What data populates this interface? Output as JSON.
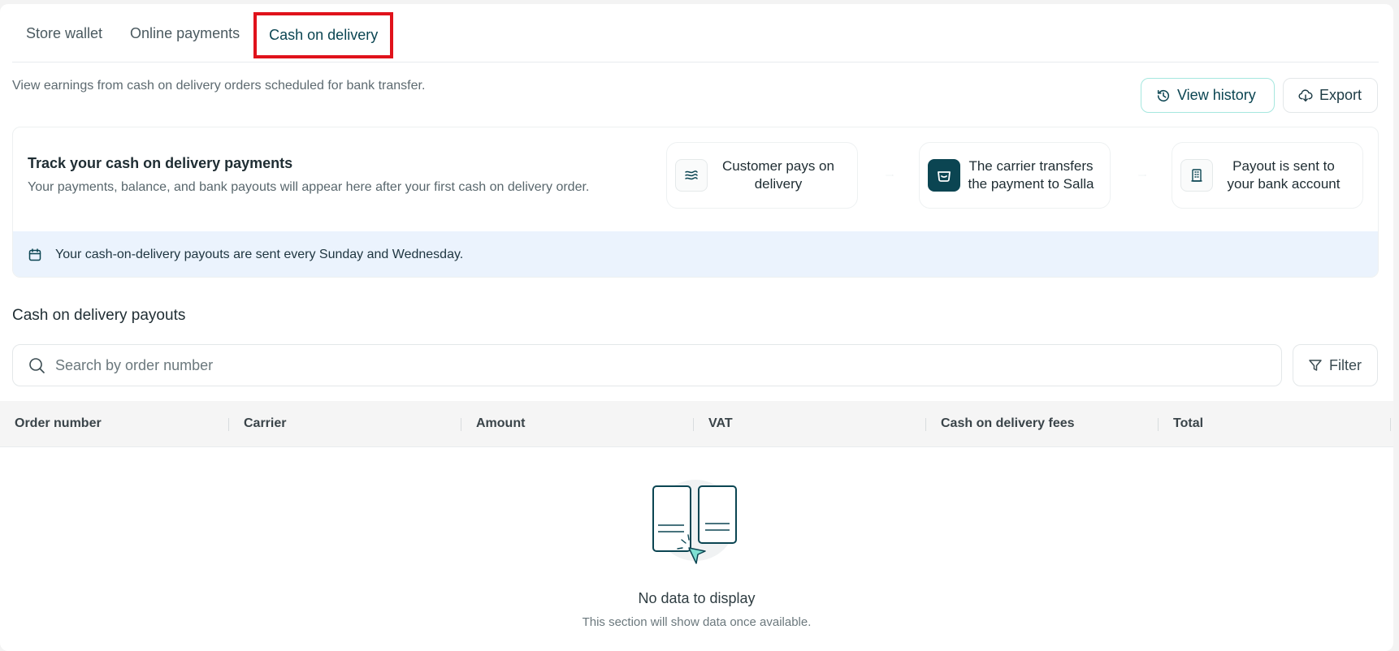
{
  "tabs": [
    {
      "label": "Store wallet"
    },
    {
      "label": "Online payments"
    },
    {
      "label": "Cash on delivery",
      "active": true
    }
  ],
  "subtitle": "View earnings from cash on delivery orders scheduled for bank transfer.",
  "actions": {
    "history_label": "View history",
    "export_label": "Export"
  },
  "tracker": {
    "title": "Track your cash on delivery payments",
    "description": "Your payments, balance, and bank payouts will appear here after your first cash on delivery order.",
    "steps": [
      {
        "label_line1": "Customer pays on",
        "label_line2": "delivery",
        "icon": "cash-icon"
      },
      {
        "label_line1": "The carrier transfers",
        "label_line2": "the payment to Salla",
        "icon": "salla-logo-icon"
      },
      {
        "label_line1": "Payout is sent to",
        "label_line2": "your bank account",
        "icon": "bank-building-icon"
      }
    ],
    "banner": "Your cash-on-delivery payouts are sent every Sunday and Wednesday."
  },
  "payouts": {
    "title": "Cash on delivery payouts",
    "search_placeholder": "Search by order number",
    "filter_label": "Filter",
    "columns": [
      "Order number",
      "Carrier",
      "Amount",
      "VAT",
      "Cash on delivery fees",
      "Total"
    ],
    "rows": [],
    "empty_title": "No data to display",
    "empty_subtitle": "This section will show data once available."
  },
  "colors": {
    "brand_dark": "#0b4552",
    "accent_teal": "#a6e7df",
    "highlight_red": "#e0121b",
    "banner_bg": "#ebf3fd"
  }
}
